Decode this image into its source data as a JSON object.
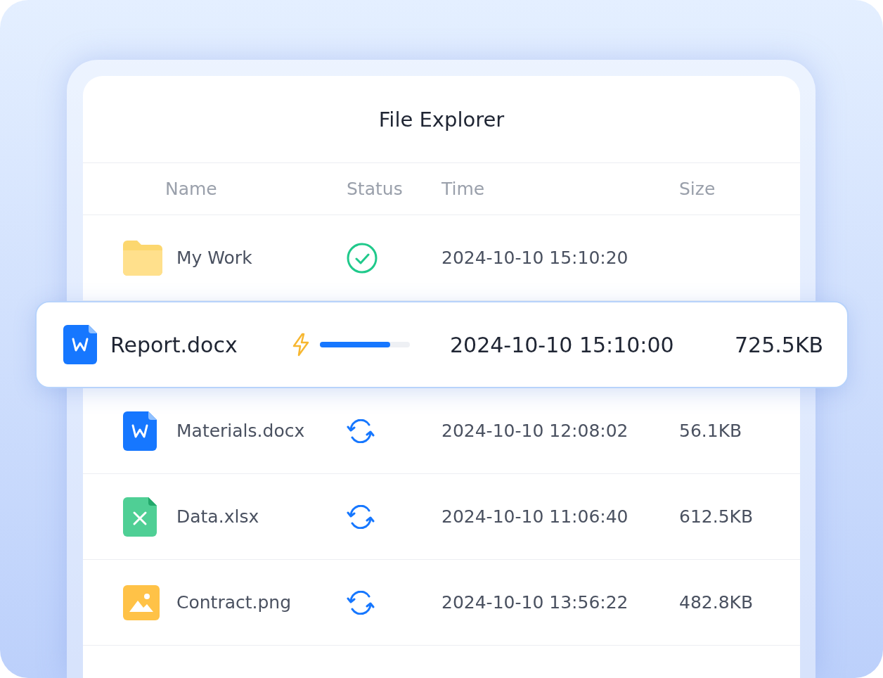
{
  "window": {
    "title": "File Explorer"
  },
  "table": {
    "columns": [
      "Name",
      "Status",
      "Time",
      "Size"
    ],
    "rows": [
      {
        "name": "My Work",
        "kind": "folder",
        "status": {
          "kind": "done"
        },
        "time": "2024-10-10 15:10:20",
        "size": "",
        "selected": false
      },
      {
        "name": "Report.docx",
        "kind": "docx",
        "status": {
          "kind": "uploading",
          "level": 0.78
        },
        "time": "2024-10-10 15:10:00",
        "size": "725.5KB",
        "selected": true
      },
      {
        "name": "Materials.docx",
        "kind": "docx",
        "status": {
          "kind": "syncing"
        },
        "time": "2024-10-10 12:08:02",
        "size": "56.1KB",
        "selected": false
      },
      {
        "name": "Data.xlsx",
        "kind": "xlsx",
        "status": {
          "kind": "syncing"
        },
        "time": "2024-10-10 11:06:40",
        "size": "612.5KB",
        "selected": false
      },
      {
        "name": "Contract.png",
        "kind": "png",
        "status": {
          "kind": "syncing"
        },
        "time": "2024-10-10 13:56:22",
        "size": "482.8KB",
        "selected": false
      }
    ]
  }
}
